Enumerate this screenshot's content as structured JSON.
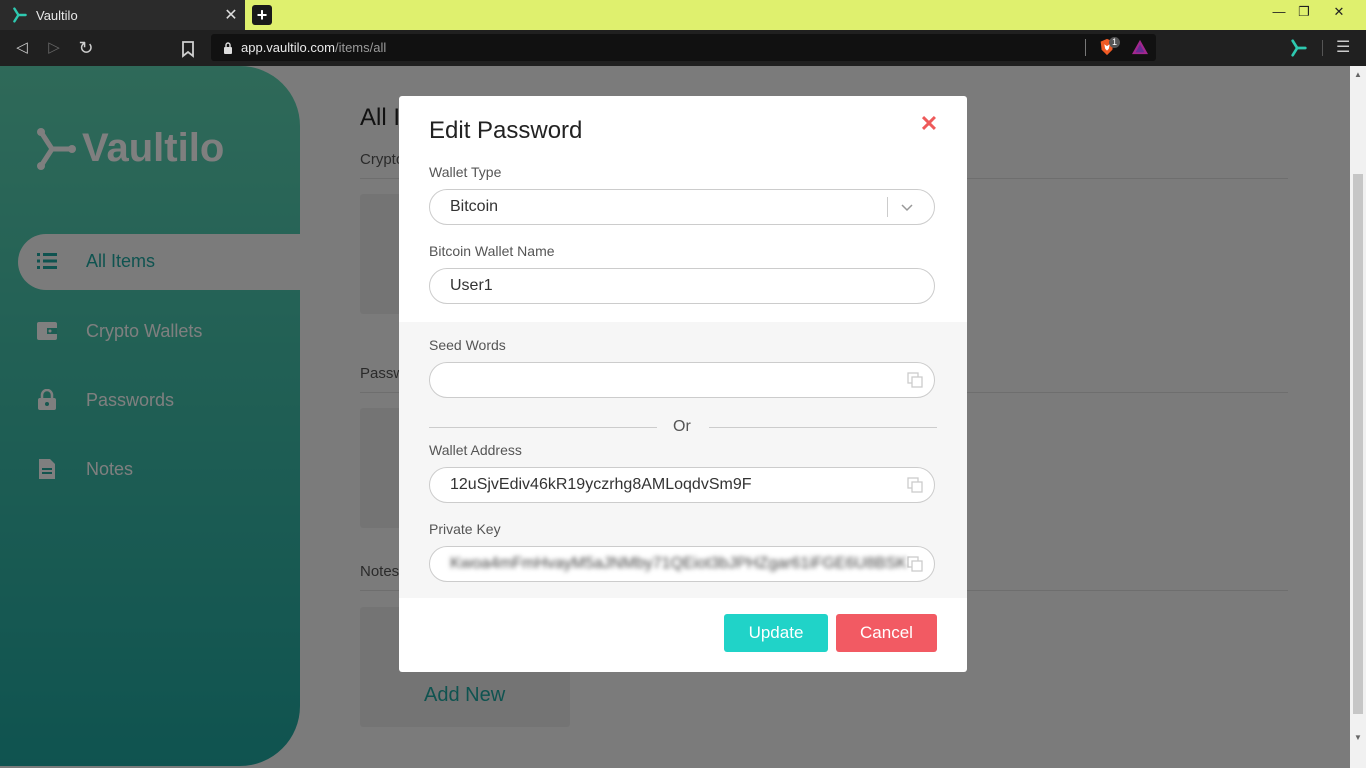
{
  "browser": {
    "tab_title": "Vaultilo",
    "tab_close": "✕",
    "new_tab": "+",
    "url_host": "app.vaultilo.com",
    "url_path": "/items/all",
    "shields_count": "1",
    "win_minimize": "—",
    "win_restore": "❐",
    "win_close": "✕",
    "menu": "☰",
    "back": "◁",
    "forward": "▷",
    "reload": "↻"
  },
  "sidebar": {
    "logo_text": "Vaultilo",
    "items": [
      {
        "label": "All Items",
        "icon": "list-icon"
      },
      {
        "label": "Crypto Wallets",
        "icon": "wallet-icon"
      },
      {
        "label": "Passwords",
        "icon": "lock-icon"
      },
      {
        "label": "Notes",
        "icon": "note-icon"
      }
    ]
  },
  "main": {
    "title": "All I",
    "sections": [
      "Crypto",
      "Passw",
      "Notes"
    ],
    "add_new": "Add New"
  },
  "modal": {
    "title": "Edit Password",
    "close": "✕",
    "wallet_type_label": "Wallet Type",
    "wallet_type_value": "Bitcoin",
    "wallet_name_label": "Bitcoin Wallet Name",
    "wallet_name_value": "User1",
    "seed_words_label": "Seed Words",
    "seed_words_value": "",
    "or_text": "Or",
    "wallet_address_label": "Wallet Address",
    "wallet_address_value": "12uSjvEdiv46kR19yczrhg8AMLoqdvSm9F",
    "private_key_label": "Private Key",
    "private_key_value": "Kwoa4mFmHvayM5aJNMby71QEiot3bJPHZgar61iFGE6U8BSKf",
    "update_label": "Update",
    "cancel_label": "Cancel"
  },
  "colors": {
    "accent": "#20d3c8",
    "danger": "#f25a63",
    "sidebar_top": "#5ed3b2",
    "sidebar_bottom": "#1fa7a0",
    "tabbar": "#dff06e"
  }
}
